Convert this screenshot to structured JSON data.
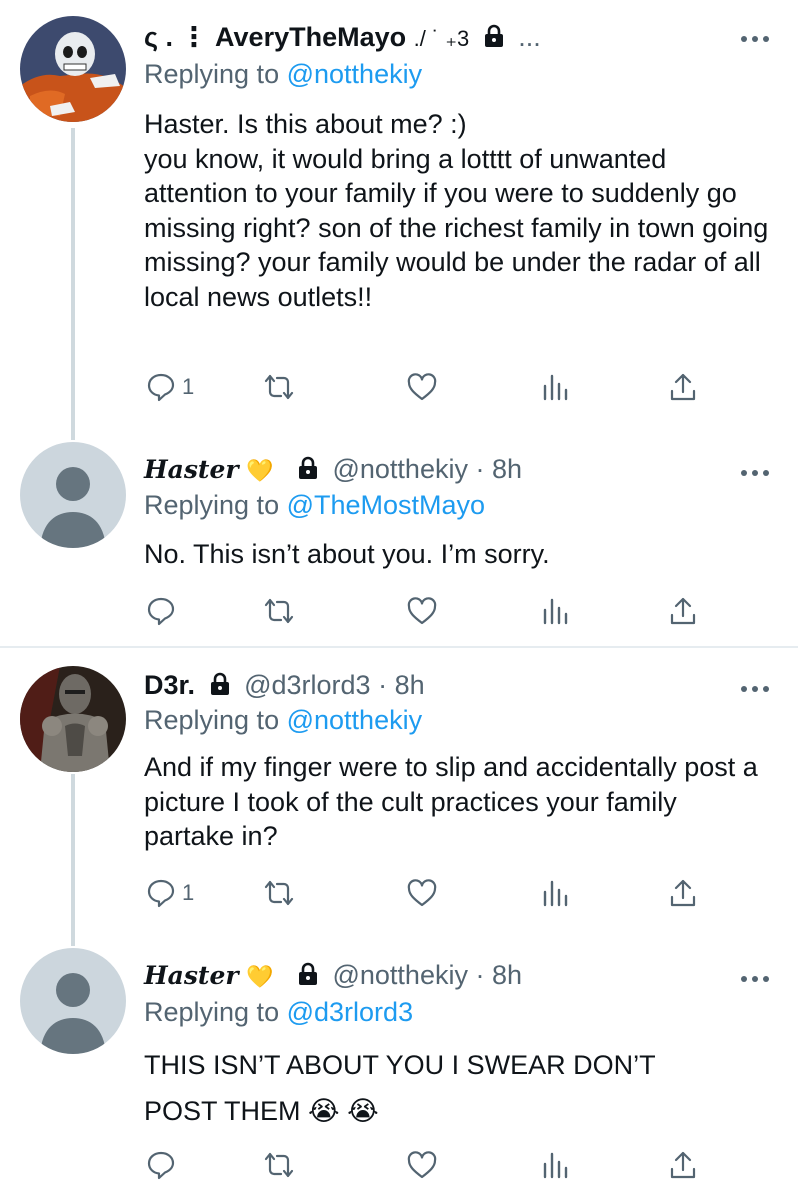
{
  "tweets": [
    {
      "display_name": "ς . ⋮ AveryTheMayo",
      "name_decor": "./ ˙ ₊3",
      "handle": "",
      "separator": "",
      "time": "",
      "header_tail": "...",
      "replying_prefix": "Replying to",
      "replying_to": "@notthekiy",
      "text": "Haster. Is this about me? :)\nyou know, it would bring a lotttt of unwanted attention to your family if you were to suddenly go missing right? son of the richest family in town going missing? your family would be under the radar of all local news outlets!!",
      "reply_count": "1"
    },
    {
      "display_name": "Haster",
      "name_emoji": "💛",
      "handle": "@notthekiy",
      "separator": "·",
      "time": "8h",
      "replying_prefix": "Replying to",
      "replying_to": "@TheMostMayo",
      "text": "No. This isn’t about you. I’m sorry.",
      "reply_count": ""
    },
    {
      "display_name": "D3r.",
      "handle": "@d3rlord3",
      "separator": "·",
      "time": "8h",
      "replying_prefix": "Replying to",
      "replying_to": "@notthekiy",
      "text": "And if my finger were to slip and accidentally post a picture I took of the cult practices your family partake in?",
      "reply_count": "1"
    },
    {
      "display_name": "Haster",
      "name_emoji": "💛",
      "handle": "@notthekiy",
      "separator": "·",
      "time": "8h",
      "replying_prefix": "Replying to",
      "replying_to": "@d3rlord3",
      "text": "THIS ISN’T ABOUT YOU I SWEAR DON’T\nPOST THEM 😭 😭",
      "reply_count": ""
    }
  ],
  "icons": [
    "more-icon",
    "reply-icon",
    "retweet-icon",
    "like-icon",
    "analytics-icon",
    "share-icon",
    "lock-icon"
  ],
  "colors": {
    "link": "#1d9bf0",
    "muted": "#536471",
    "thread_line": "#cfd9de",
    "default_avatar_bg": "#ccd6dd",
    "default_avatar_fg": "#66757f"
  }
}
